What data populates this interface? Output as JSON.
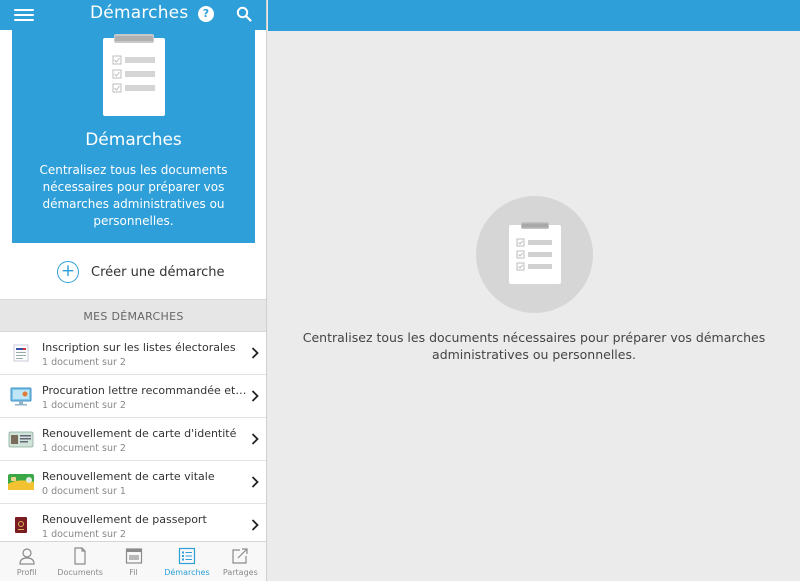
{
  "header": {
    "title": "Démarches"
  },
  "hero": {
    "heading": "Démarches",
    "description": "Centralisez tous les documents nécessaires pour préparer vos démarches administratives ou personnelles."
  },
  "create_button": {
    "icon": "+",
    "label": "Créer une démarche"
  },
  "section": {
    "title": "MES DÉMARCHES"
  },
  "items": [
    {
      "name": "Inscription sur les listes électorales",
      "count": "1 document sur 2",
      "icon": "ballot-icon"
    },
    {
      "name": "Procuration lettre recommandée et c...",
      "count": "1 document sur 2",
      "icon": "computer-icon"
    },
    {
      "name": "Renouvellement de carte d'identité",
      "count": "1 document sur 2",
      "icon": "id-card-icon"
    },
    {
      "name": "Renouvellement de carte vitale",
      "count": "0 document sur 1",
      "icon": "vitale-card-icon"
    },
    {
      "name": "Renouvellement de passeport",
      "count": "1 document sur 2",
      "icon": "passport-icon"
    }
  ],
  "tabs": [
    {
      "label": "Profil",
      "icon": "person-icon",
      "active": false
    },
    {
      "label": "Documents",
      "icon": "document-icon",
      "active": false
    },
    {
      "label": "Fil",
      "icon": "feed-icon",
      "active": false
    },
    {
      "label": "Démarches",
      "icon": "checklist-icon",
      "active": true
    },
    {
      "label": "Partages",
      "icon": "share-icon",
      "active": false
    }
  ],
  "detail": {
    "empty_message": "Centralisez tous les documents nécessaires pour préparer vos démarches administratives ou personnelles."
  },
  "colors": {
    "accent": "#2e9fd8",
    "background": "#ebebeb"
  }
}
